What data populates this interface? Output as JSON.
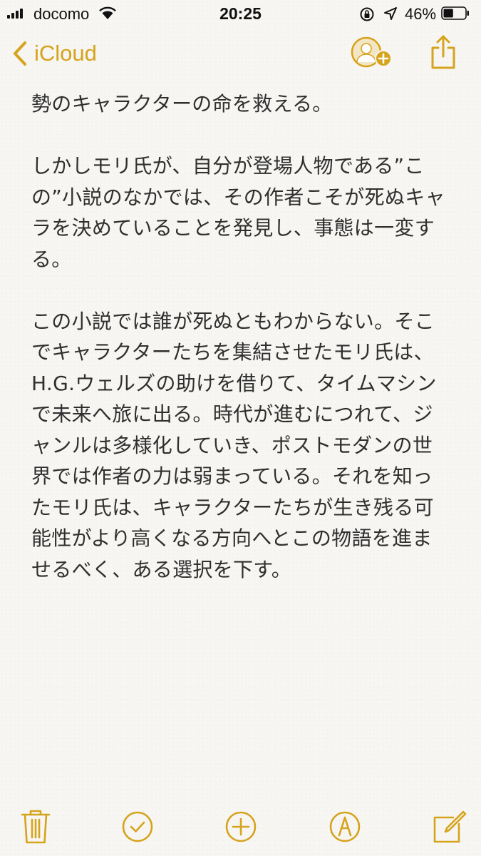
{
  "status_bar": {
    "carrier": "docomo",
    "time": "20:25",
    "battery_percent": "46%",
    "battery_level": 0.46
  },
  "nav": {
    "back_label": "iCloud"
  },
  "note": {
    "lines": [
      "勢のキャラクターの命を救える。",
      "",
      "しかしモリ氏が、自分が登場人物である”こ",
      "の”小説のなかでは、その作者こそが死ぬキャ",
      "ラを決めていることを発見し、事態は一変す",
      "る。",
      "",
      "この小説では誰が死ぬともわからない。そこ",
      "でキャラクターたちを集結させたモリ氏は、",
      "H.G.ウェルズの助けを借りて、タイムマシン",
      "で未来へ旅に出る。時代が進むにつれて、ジ",
      "ャンルは多様化していき、ポストモダンの世",
      "界では作者の力は弱まっている。それを知っ",
      "たモリ氏は、キャラクターたちが生き残る可",
      "能性がより高くなる方向へとこの物語を進ま",
      "せるべく、ある選択を下す。"
    ]
  },
  "toolbar": {
    "items": [
      "trash-icon",
      "checklist-icon",
      "add-icon",
      "markup-icon",
      "compose-icon"
    ]
  },
  "colors": {
    "accent": "#d6a31c",
    "background": "#f7f6f3",
    "text": "#2f2f2f"
  }
}
